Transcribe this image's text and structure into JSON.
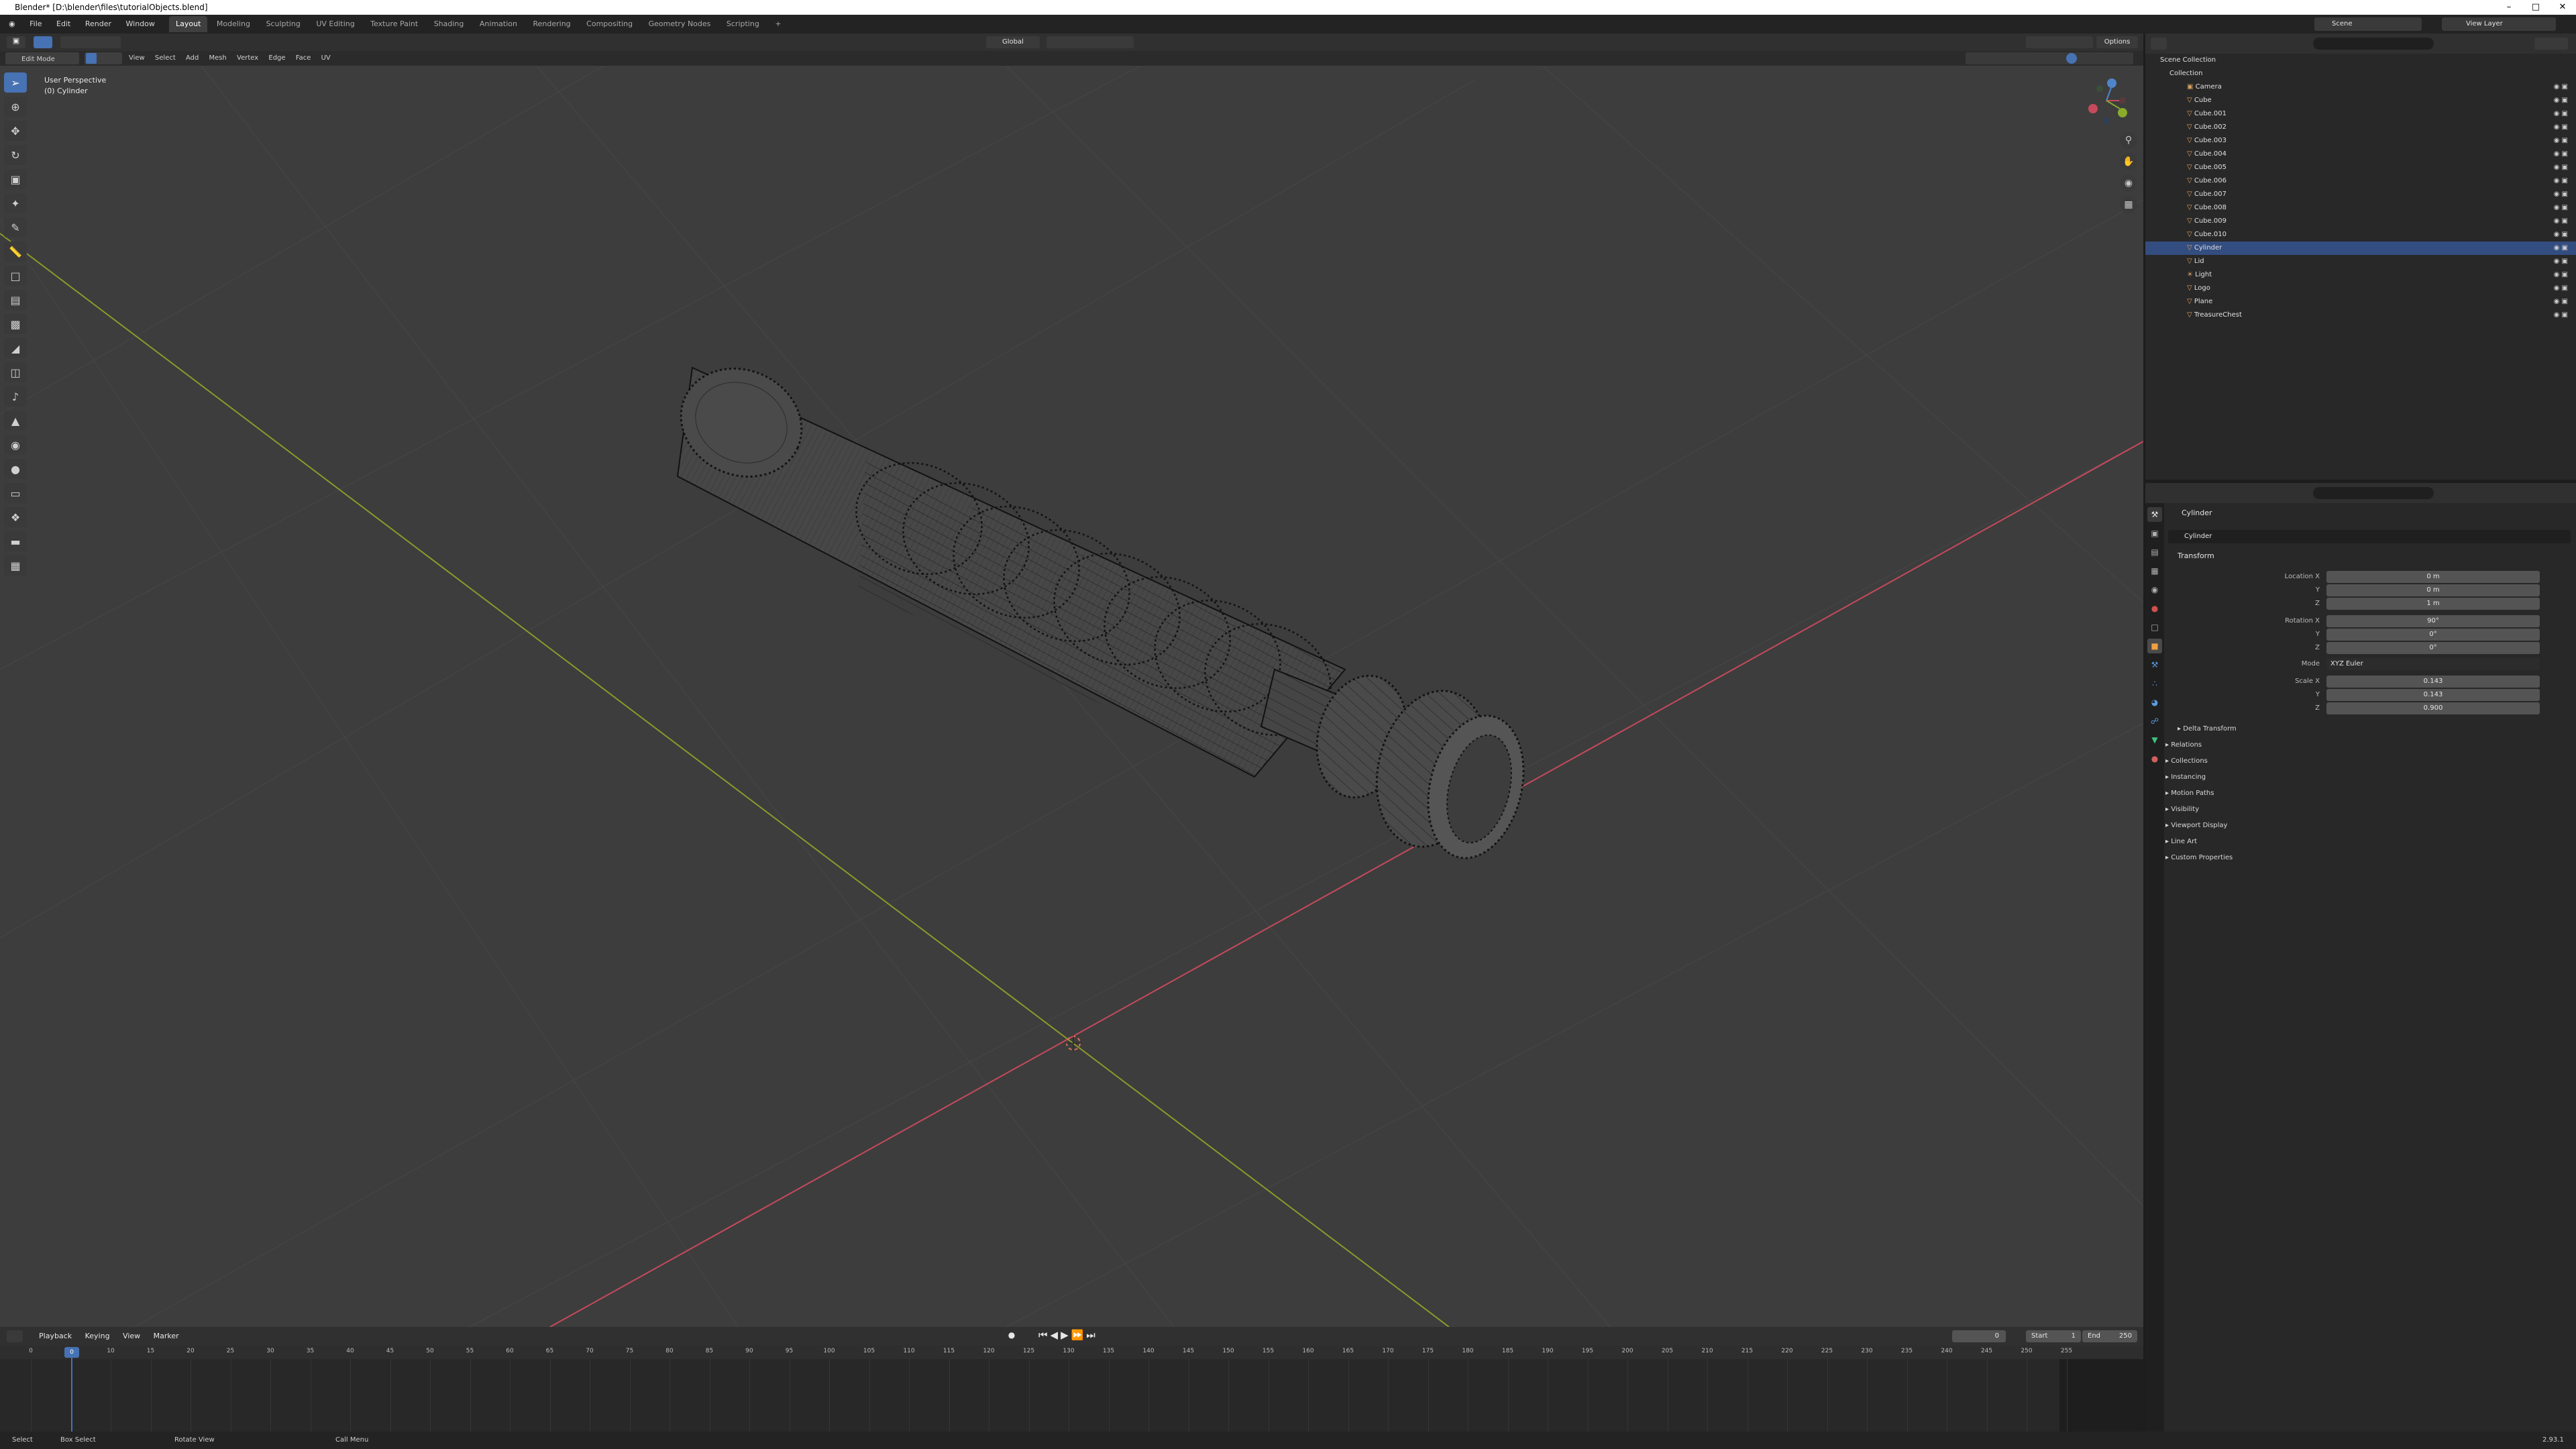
{
  "title": "Blender* [D:\\blender\\files\\tutorialObjects.blend]",
  "menu": [
    "File",
    "Edit",
    "Render",
    "Window",
    "Help"
  ],
  "workspaces": [
    "Layout",
    "Modeling",
    "Sculpting",
    "UV Editing",
    "Texture Paint",
    "Shading",
    "Animation",
    "Rendering",
    "Compositing",
    "Geometry Nodes",
    "Scripting",
    "+"
  ],
  "scene": {
    "label": "Scene",
    "view_layer": "View Layer"
  },
  "header": {
    "orientation": "Global",
    "options": "Options"
  },
  "viewport": {
    "mode": "Edit Mode",
    "menus": [
      "View",
      "Select",
      "Add",
      "Mesh",
      "Vertex",
      "Edge",
      "Face",
      "UV"
    ],
    "overlay_title": "User Perspective",
    "overlay_object": "(0) Cylinder",
    "colors": {
      "bg": "#3d3d3d",
      "x_axis": "#c64a5c",
      "y_axis": "#8a9a2a"
    }
  },
  "outliner": {
    "root": "Scene Collection",
    "collection": "Collection",
    "items": [
      "Camera",
      "Cube",
      "Cube.001",
      "Cube.002",
      "Cube.003",
      "Cube.004",
      "Cube.005",
      "Cube.006",
      "Cube.007",
      "Cube.008",
      "Cube.009",
      "Cube.010",
      "Cylinder",
      "Lid",
      "Light",
      "Logo",
      "Plane",
      "TreasureChest"
    ],
    "selected": "Cylinder"
  },
  "properties": {
    "object_name": "Cylinder",
    "data_name": "Cylinder",
    "transform_header": "Transform",
    "location_label": "Location X",
    "location": [
      "0 m",
      "0 m",
      "1 m"
    ],
    "rotation_label": "Rotation X",
    "rotation": [
      "90°",
      "0°",
      "0°"
    ],
    "mode_label": "Mode",
    "mode_value": "XYZ Euler",
    "scale_label": "Scale X",
    "scale": [
      "0.143",
      "0.143",
      "0.900"
    ],
    "axis_y": "Y",
    "axis_z": "Z",
    "delta": "Delta Transform",
    "panels": [
      "Relations",
      "Collections",
      "Instancing",
      "Motion Paths",
      "Visibility",
      "Viewport Display",
      "Line Art",
      "Custom Properties"
    ]
  },
  "timeline": {
    "menus": [
      "Playback",
      "Keying",
      "View",
      "Marker"
    ],
    "current_frame": "0",
    "start_label": "Start",
    "start": "1",
    "end_label": "End",
    "end": "250",
    "ticks": [
      "0",
      "5",
      "10",
      "15",
      "20",
      "25",
      "30",
      "35",
      "40",
      "45",
      "50",
      "55",
      "60",
      "65",
      "70",
      "75",
      "80",
      "85",
      "90",
      "95",
      "100",
      "105",
      "110",
      "115",
      "120",
      "125",
      "130",
      "135",
      "140",
      "145",
      "150",
      "155",
      "160",
      "165",
      "170",
      "175",
      "180",
      "185",
      "190",
      "195",
      "200",
      "205",
      "210",
      "215",
      "220",
      "225",
      "230",
      "235",
      "240",
      "245",
      "250",
      "255"
    ]
  },
  "status": {
    "select": "Select",
    "box_select": "Box Select",
    "rotate": "Rotate View",
    "call_menu": "Call Menu",
    "version": "2.93.1"
  }
}
